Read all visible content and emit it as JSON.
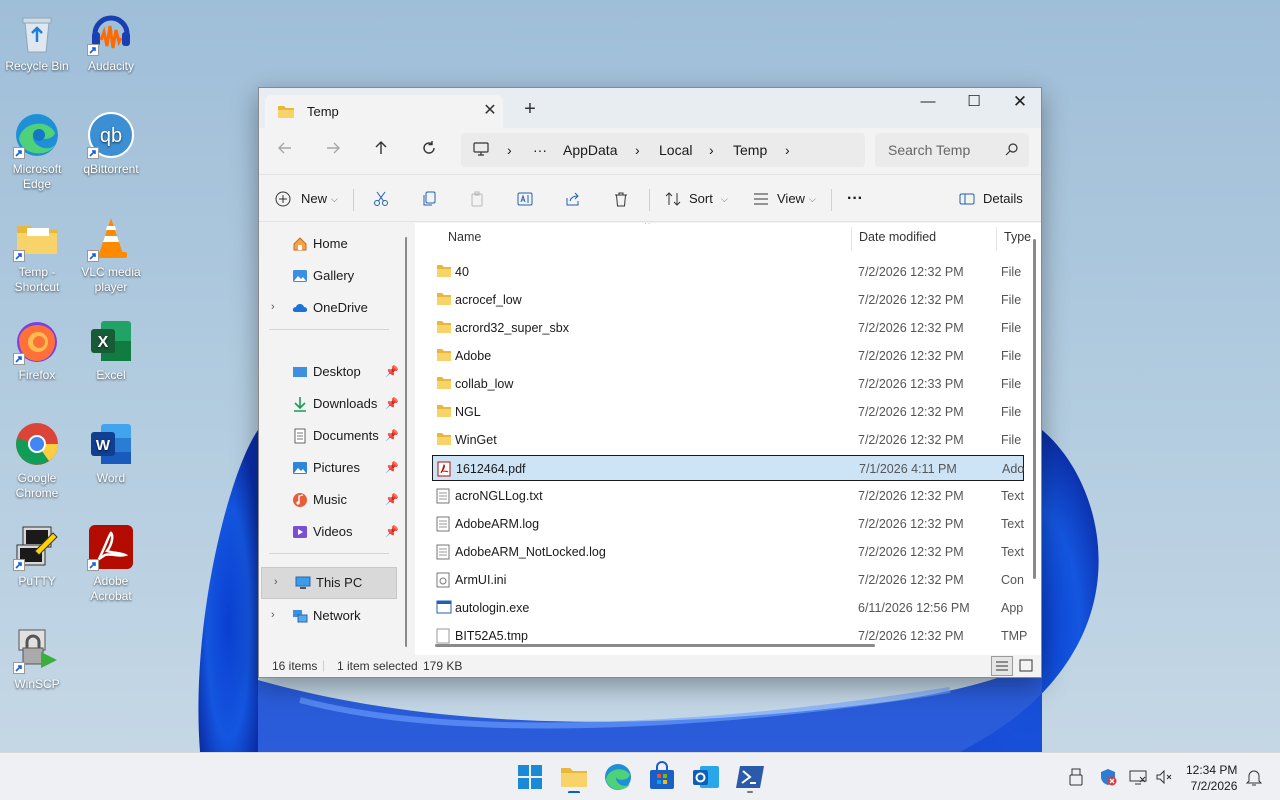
{
  "desktop": {
    "icons": [
      {
        "label": "Recycle Bin"
      },
      {
        "label": "Audacity"
      },
      {
        "label": "Microsoft Edge"
      },
      {
        "label": "qBittorrent"
      },
      {
        "label": "Temp - Shortcut"
      },
      {
        "label": "VLC media player"
      },
      {
        "label": "Firefox"
      },
      {
        "label": "Excel"
      },
      {
        "label": "Google Chrome"
      },
      {
        "label": "Word"
      },
      {
        "label": "PuTTY"
      },
      {
        "label": "Adobe Acrobat"
      },
      {
        "label": "WinSCP"
      }
    ]
  },
  "window": {
    "tab_title": "Temp",
    "tab_close": "✕",
    "new_tab": "+",
    "controls": {
      "minimize": "—",
      "maximize": "☐",
      "close": "✕"
    },
    "address": {
      "more": "···",
      "crumbs": [
        "AppData",
        "Local",
        "Temp"
      ]
    },
    "search_placeholder": "Search Temp",
    "toolbar": {
      "new_label": "New",
      "sort_label": "Sort",
      "view_label": "View",
      "more_label": "···",
      "details_label": "Details"
    },
    "nav": {
      "items": [
        {
          "label": "Home"
        },
        {
          "label": "Gallery"
        },
        {
          "label": "OneDrive"
        },
        {
          "label": "Desktop"
        },
        {
          "label": "Downloads"
        },
        {
          "label": "Documents"
        },
        {
          "label": "Pictures"
        },
        {
          "label": "Music"
        },
        {
          "label": "Videos"
        },
        {
          "label": "This PC"
        },
        {
          "label": "Network"
        }
      ]
    },
    "columns": {
      "name": "Name",
      "date": "Date modified",
      "type": "Type"
    },
    "files": [
      {
        "name": "40",
        "date": "7/2/2026 12:32 PM",
        "type": "File",
        "kind": "folder"
      },
      {
        "name": "acrocef_low",
        "date": "7/2/2026 12:32 PM",
        "type": "File",
        "kind": "folder"
      },
      {
        "name": "acrord32_super_sbx",
        "date": "7/2/2026 12:32 PM",
        "type": "File",
        "kind": "folder"
      },
      {
        "name": "Adobe",
        "date": "7/2/2026 12:32 PM",
        "type": "File",
        "kind": "folder"
      },
      {
        "name": "collab_low",
        "date": "7/2/2026 12:33 PM",
        "type": "File",
        "kind": "folder"
      },
      {
        "name": "NGL",
        "date": "7/2/2026 12:32 PM",
        "type": "File",
        "kind": "folder"
      },
      {
        "name": "WinGet",
        "date": "7/2/2026 12:32 PM",
        "type": "File",
        "kind": "folder"
      },
      {
        "name": "1612464.pdf",
        "date": "7/1/2026 4:11 PM",
        "type": "Ado",
        "kind": "pdf"
      },
      {
        "name": "acroNGLLog.txt",
        "date": "7/2/2026 12:32 PM",
        "type": "Text",
        "kind": "txt"
      },
      {
        "name": "AdobeARM.log",
        "date": "7/2/2026 12:32 PM",
        "type": "Text",
        "kind": "txt"
      },
      {
        "name": "AdobeARM_NotLocked.log",
        "date": "7/2/2026 12:32 PM",
        "type": "Text",
        "kind": "txt"
      },
      {
        "name": "ArmUI.ini",
        "date": "7/2/2026 12:32 PM",
        "type": "Con",
        "kind": "ini"
      },
      {
        "name": "autologin.exe",
        "date": "6/11/2026 12:56 PM",
        "type": "App",
        "kind": "exe"
      },
      {
        "name": "BIT52A5.tmp",
        "date": "7/2/2026 12:32 PM",
        "type": "TMP",
        "kind": "tmp"
      }
    ],
    "status": {
      "count": "16 items",
      "selected": "1 item selected",
      "size": "179 KB"
    }
  },
  "taskbar": {
    "clock_time": "12:34 PM",
    "clock_date": "7/2/2026"
  },
  "colors": {
    "accent": "#0067c0",
    "selection": "#cde4f7",
    "folder": "#f6c445"
  }
}
